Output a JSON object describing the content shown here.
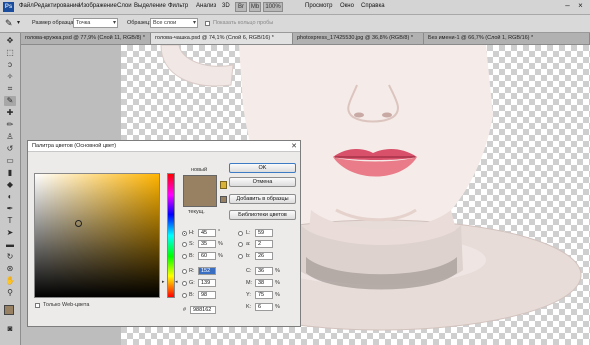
{
  "menubar": {
    "logo": "Ps",
    "items": [
      "Файл",
      "Редактирование",
      "Изображение",
      "Слои",
      "Выделение",
      "Фильтр",
      "Анализ",
      "3D",
      "Просмотр",
      "Окно",
      "Справка"
    ],
    "zoom": "100%"
  },
  "options": {
    "sample_size_label": "Размер образца:",
    "sample_size_value": "Точка",
    "sample_label": "Образец:",
    "sample_value": "Все слои",
    "show_ring_label": "Показать кольцо пробы"
  },
  "tabs": [
    "голова-кружка.psd @ 77,9% (Слой 11, RGB/8) *",
    "голова-чашка.psd @ 74,1% (Слой 6, RGB/16) *",
    "photoxpress_17425530.jpg @ 36,8% (RGB/8) *",
    "Без имени-1 @ 66,7% (Слой 1, RGB/16) *"
  ],
  "dialog": {
    "title": "Палитра цветов (Основной цвет)",
    "new_label": "новый",
    "current_label": "текущ.",
    "ok": "OK",
    "cancel": "Отмена",
    "add_to_swatches": "Добавить в образцы",
    "color_libraries": "Библиотеки цветов",
    "web_only": "Только Web-цвета",
    "hsb": {
      "H": {
        "label": "H:",
        "value": "45",
        "unit": "°"
      },
      "S": {
        "label": "S:",
        "value": "35",
        "unit": "%"
      },
      "B": {
        "label": "B:",
        "value": "60",
        "unit": "%"
      }
    },
    "rgb": {
      "R": {
        "label": "R:",
        "value": "152"
      },
      "G": {
        "label": "G:",
        "value": "139"
      },
      "B": {
        "label": "B:",
        "value": "98"
      }
    },
    "lab": {
      "L": {
        "label": "L:",
        "value": "59"
      },
      "a": {
        "label": "a:",
        "value": "2"
      },
      "b": {
        "label": "b:",
        "value": "26"
      }
    },
    "cmyk": {
      "C": {
        "label": "C:",
        "value": "36",
        "unit": "%"
      },
      "M": {
        "label": "M:",
        "value": "38",
        "unit": "%"
      },
      "Y": {
        "label": "Y:",
        "value": "75",
        "unit": "%"
      },
      "K": {
        "label": "K:",
        "value": "6",
        "unit": "%"
      }
    },
    "hex_label": "#",
    "hex_value": "988162"
  },
  "colors": {
    "picked": "#988162",
    "skin": "#f4e7e3",
    "lips": "#e06b7a"
  }
}
